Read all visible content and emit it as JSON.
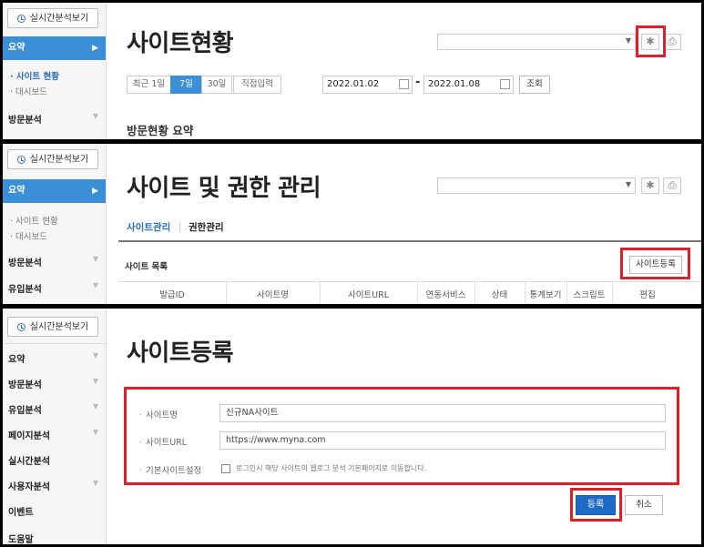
{
  "sidebar": {
    "realtime_button": "실시간분석보기",
    "summary": "요약",
    "sub_site_status": "사이트 현황",
    "sub_dashboard": "대시보드",
    "visit_analysis": "방문분석",
    "inflow_analysis": "유입분석",
    "page_analysis": "페이지분석",
    "realtime_analysis": "실시간분석",
    "user_analysis": "사용자분석",
    "event": "이벤트",
    "help": "도움말"
  },
  "panel1": {
    "title": "사이트현황",
    "ranges": [
      "최근 1일",
      "7일",
      "30일",
      "직접입력"
    ],
    "start_date": "2022.01.02",
    "end_date": "2022.01.08",
    "query_button": "조회",
    "section_title": "방문현황 요약"
  },
  "panel2": {
    "title": "사이트 및 권한 관리",
    "tab_site": "사이트관리",
    "tab_permission": "권한관리",
    "list_title": "사이트 목록",
    "register_button": "사이트등록",
    "columns": [
      "발급ID",
      "사이트명",
      "사이트URL",
      "연동서비스",
      "상태",
      "통계보기",
      "스크립트",
      "편집"
    ]
  },
  "panel3": {
    "title": "사이트등록",
    "site_name_label": "사이트명",
    "site_name_value": "신규NA사이트",
    "site_url_label": "사이트URL",
    "site_url_value": "https://www.myna.com",
    "default_site_label": "기본사이트설정",
    "default_site_text": "로그인시 해당 사이트의 웹로그 분석 기본페이지로 이동합니다.",
    "submit_button": "등록",
    "cancel_button": "취소"
  },
  "colors": {
    "accent": "#3a8fd6",
    "highlight": "#e41e26",
    "primary": "#1d6bc7"
  },
  "icons": {
    "settings": "gear-icon",
    "print": "printer-icon",
    "realtime": "clock-icon",
    "calendar": "calendar-icon"
  }
}
